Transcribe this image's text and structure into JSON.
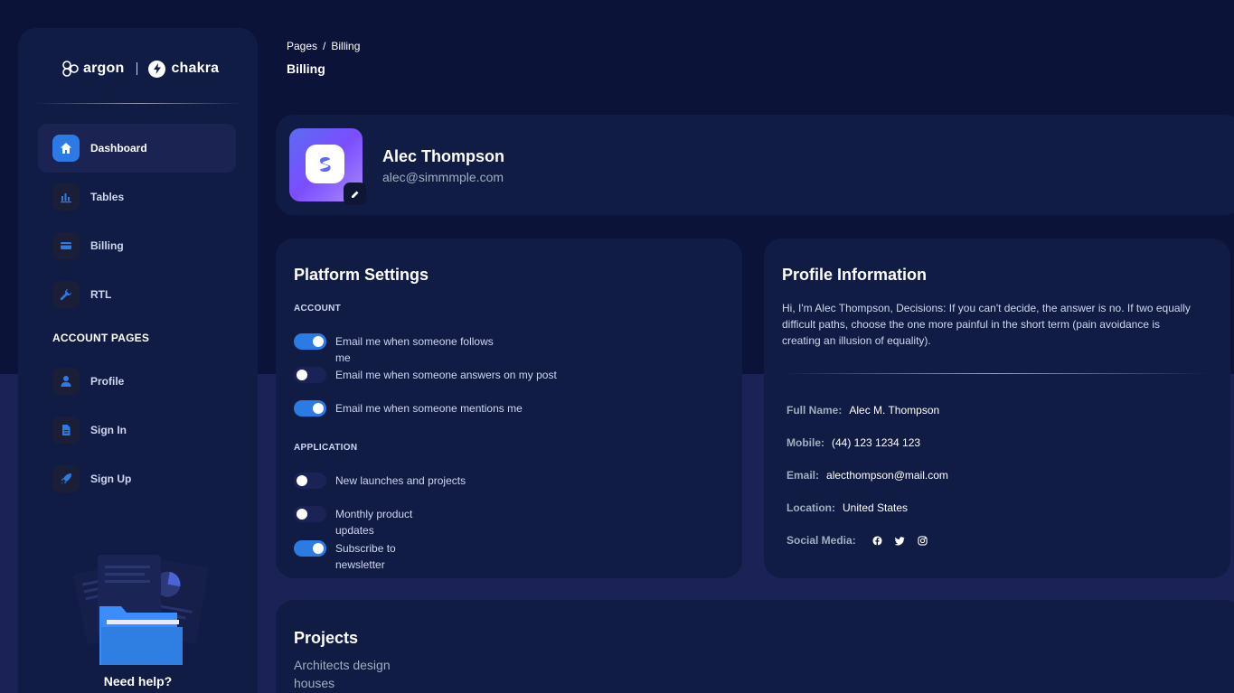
{
  "brand": {
    "name_left": "argon",
    "name_right": "chakra"
  },
  "sidebar": {
    "items": [
      {
        "label": "Dashboard",
        "icon": "home-icon",
        "active": true
      },
      {
        "label": "Tables",
        "icon": "chart-bar-icon",
        "active": false
      },
      {
        "label": "Billing",
        "icon": "credit-card-icon",
        "active": false
      },
      {
        "label": "RTL",
        "icon": "wrench-icon",
        "active": false
      }
    ],
    "section_title": "ACCOUNT PAGES",
    "account_items": [
      {
        "label": "Profile",
        "icon": "person-icon"
      },
      {
        "label": "Sign In",
        "icon": "document-icon"
      },
      {
        "label": "Sign Up",
        "icon": "rocket-icon"
      }
    ],
    "help_title": "Need help?"
  },
  "header": {
    "breadcrumb": [
      "Pages",
      "Billing"
    ],
    "breadcrumb_sep": "/",
    "title": "Billing"
  },
  "profile": {
    "name": "Alec Thompson",
    "email": "alec@simmmple.com"
  },
  "platform_settings": {
    "title": "Platform Settings",
    "account_label": "ACCOUNT",
    "account": [
      {
        "label": "Email me when someone follows me",
        "on": true
      },
      {
        "label": "Email me when someone answers on my post",
        "on": false
      },
      {
        "label": "Email me when someone mentions me",
        "on": true
      }
    ],
    "application_label": "APPLICATION",
    "application": [
      {
        "label": "New launches and projects",
        "on": false
      },
      {
        "label": "Monthly product updates",
        "on": false
      },
      {
        "label": "Subscribe to newsletter",
        "on": true
      }
    ]
  },
  "profile_info": {
    "title": "Profile Information",
    "description": "Hi, I'm Alec Thompson, Decisions: If you can't decide, the answer is no. If two equally difficult paths, choose the one more painful in the short term (pain avoidance is creating an illusion of equality).",
    "rows": [
      {
        "key": "Full Name:",
        "value": "Alec M. Thompson"
      },
      {
        "key": "Mobile:",
        "value": "(44) 123 1234 123"
      },
      {
        "key": "Email:",
        "value": "alecthompson@mail.com"
      },
      {
        "key": "Location:",
        "value": "United States"
      }
    ],
    "social_label": "Social Media:",
    "social_icons": [
      "facebook-icon",
      "twitter-icon",
      "instagram-icon"
    ]
  },
  "projects": {
    "title": "Projects",
    "subtitle": "Architects design houses"
  },
  "colors": {
    "background": "#0b1438",
    "card": "#111c44",
    "accent": "#2c7be5",
    "muted_text": "#a0aec0"
  }
}
